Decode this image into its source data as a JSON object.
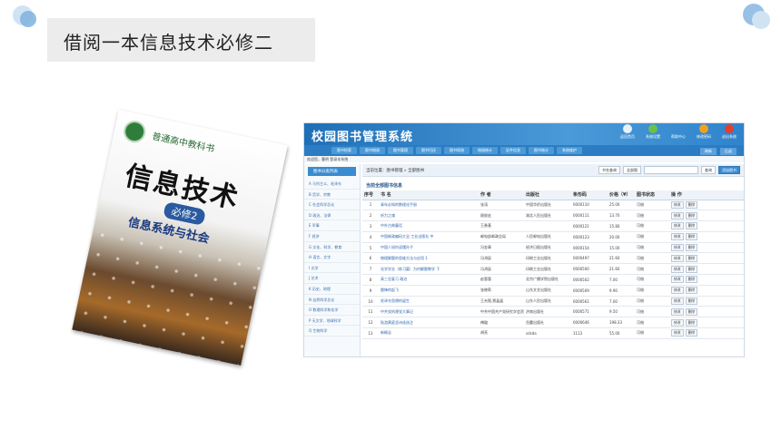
{
  "slide": {
    "title": "借阅一本信息技术必修二",
    "colors": {
      "accent_light": "#cfe3f3",
      "accent": "#7fb2de",
      "title_bg": "#ececec"
    }
  },
  "book": {
    "series": "普通高中教科书",
    "title": "信息技术",
    "volume": "必修2",
    "subtitle": "信息系统与社会"
  },
  "system": {
    "logo": "校园图书管理系统",
    "toolbar_icons": [
      {
        "icon": "home-icon",
        "label": "返回首页"
      },
      {
        "icon": "gear-icon",
        "label": "系统设置"
      },
      {
        "icon": "help-icon",
        "label": "帮助中心"
      },
      {
        "icon": "warning-icon",
        "label": "修改密码"
      },
      {
        "icon": "power-icon",
        "label": "退出系统"
      }
    ],
    "nav": [
      "图书检索",
      "图书借阅",
      "图书管理",
      "图书归还",
      "图书续借",
      "借阅统计",
      "证件信息",
      "图书统计",
      "系统维护"
    ],
    "welcome": "欢迎您，曹明 登录本系统",
    "top_buttons": [
      "刷新",
      "后退"
    ],
    "sidebar_head": "图书分类列表",
    "sidebar_items": [
      "A 马列主义、毛泽东",
      "B 哲学、宗教",
      "C 社会科学总论",
      "D 政治、法律",
      "E 军事",
      "F 经济",
      "G 文化、科学、教育",
      "H 语言、文字",
      "I 文学",
      "J 艺术",
      "K 历史、地理",
      "N 自然科学总论",
      "O 数理科学和化学",
      "P 天文学、地球科学",
      "Q 生物科学"
    ],
    "location_label": "当前位置：",
    "location_path": "图书管理 » 全部图书",
    "search": {
      "field": "书名查询",
      "scope": "全部图",
      "button": "查询",
      "add": "添加图书"
    },
    "table_title": "当前全部图书信息",
    "columns": [
      "序号",
      "书 名",
      "作 者",
      "出版社",
      "条形码",
      "价格（¥）",
      "图书状态",
      "操 作"
    ],
    "op_labels": [
      "修改",
      "删除"
    ],
    "rows": [
      [
        "1",
        "青年必知的数理化手册",
        "张涛",
        "中国华侨出版社",
        "0000110",
        "25.00",
        "可借"
      ],
      [
        "2",
        "听力之魂",
        "顾俊宏",
        "湖北人民出版社",
        "0000111",
        "13.70",
        "可借"
      ],
      [
        "3",
        "中外古典童话",
        "王勇基",
        "",
        "0000121",
        "15.80",
        "可借"
      ],
      [
        "4",
        "中国邮政编码大全.工业出版社 中",
        "邮电部邮政总局",
        "人民邮电出版社",
        "0000123",
        "20.00",
        "可借"
      ],
      [
        "5",
        "中国人如何读懂孙子",
        "冯金章",
        "经济日报出版社",
        "0000154",
        "15.00",
        "可借"
      ],
      [
        "6",
        "物理解题的思维方法与应用 1",
        "冯鸿辰",
        "印刷工业出版社",
        "0000497",
        "21.60",
        "可借"
      ],
      [
        "7",
        "化学学业（练习篇）为何解题教学 下",
        "冯鸿辰",
        "印刷工业出版社",
        "0000500",
        "21.60",
        "可借"
      ],
      [
        "8",
        "高三总复习 政治",
        "赵蓉蓉",
        "北京广播学院出版社",
        "0000502",
        "7.00",
        "可借"
      ],
      [
        "9",
        "雷锋的起飞",
        "张晓莉",
        "山东文艺出版社",
        "0000509",
        "9.90",
        "可借"
      ],
      [
        "10",
        "毛泽东思想的诞生",
        "王夫稳,贾晶晶",
        "山东人民出版社",
        "0000561",
        "7.00",
        "可借"
      ],
      [
        "11",
        "中共党的建党大事记",
        "中共中国共产党研究学会资料室",
        "济南出版社",
        "0000571",
        "9.50",
        "可借"
      ],
      [
        "12",
        "陆游黄庭坚诗选选注",
        "傅璇",
        "岳麓出版社",
        "0000646",
        "198.33",
        "可借"
      ],
      [
        "13",
        "新概念",
        "胡亮",
        "sdsda",
        "1113",
        "55.00",
        "可借"
      ]
    ]
  }
}
